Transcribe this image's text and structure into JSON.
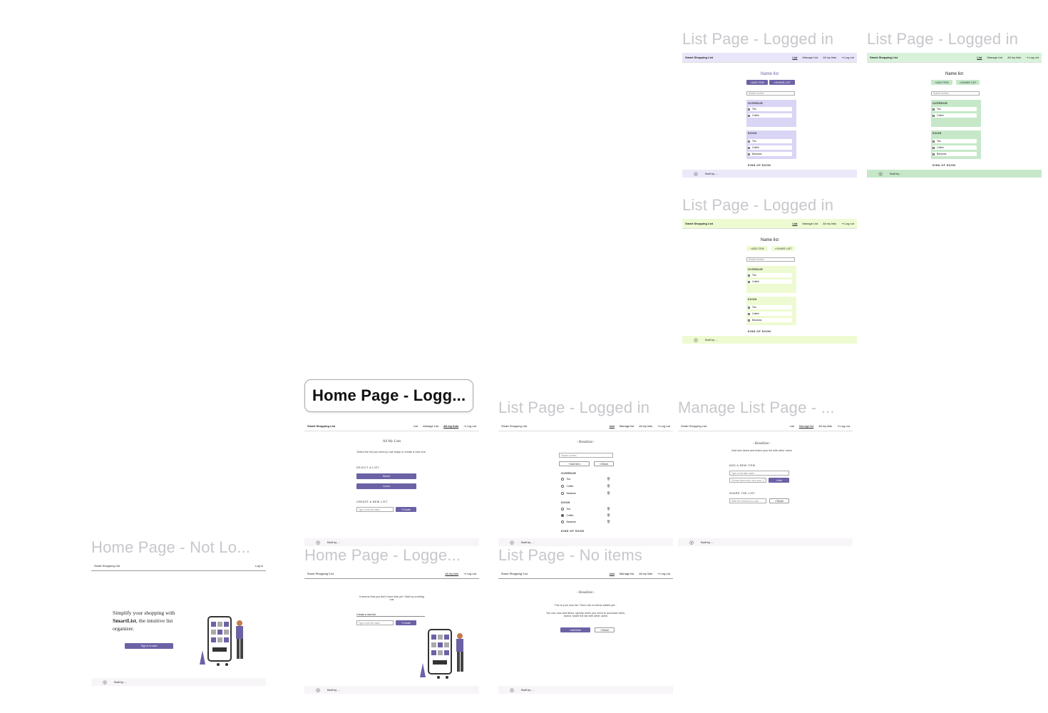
{
  "frames": {
    "list_purple": "List Page - Logged in",
    "list_green": "List Page - Logged in",
    "list_lime": "List Page - Logged in",
    "home_logged": "Home Page - Logg...",
    "list_main": "List Page - Logged in",
    "manage": "Manage List Page - ...",
    "home_not": "Home Page - Not Lo...",
    "home_logged2": "Home Page - Logge...",
    "list_empty": "List Page - No items"
  },
  "nav": {
    "brand": "Smart Shopping List",
    "list": "List",
    "manage": "Manage List",
    "manage_lc": "Manage list",
    "all": "All my lists",
    "logout": "Log out",
    "login": "Log in"
  },
  "footer": "Built by ...",
  "variant": {
    "title": "Name list",
    "add_item": "ADD ITEM",
    "share": "SHARE LIST",
    "search": "Search an item",
    "overdue": "OVERDUE",
    "soon": "SOON",
    "kind": "KIND OF SOON",
    "tea": "Tea",
    "coffee": "Coffee",
    "bananas": "Bananas"
  },
  "home": {
    "title": "All My Lists",
    "intro": "Select the list you need yo use today or create a new one.",
    "select": "SELECT A LIST",
    "list1": "Dinner",
    "list2": "Lunch",
    "create": "CREATE A NEW LIST",
    "placeholder": "Type a new list name",
    "create_btn": "Create"
  },
  "list": {
    "title": "- Breakfast -",
    "search": "Search an item",
    "add": "Add item",
    "share": "Share",
    "overdue": "OVERDUE",
    "soon": "SOON",
    "kind": "KIND OF SOON",
    "tea": "Tea",
    "coffee": "Coffee",
    "bananas": "Bananas"
  },
  "manage": {
    "title": "- Breakfast -",
    "intro": "Add new items and share your list with other users",
    "add_label": "ADD A NEW ITEM",
    "item_ph": "Type a new item name",
    "when_ph": "Choose when next, very soon, (7",
    "add_btn": "Add",
    "share_label": "SHARE THE LIST",
    "share_ph": "Write the email from a user",
    "share_btn": "Share"
  },
  "not_logged": {
    "line1": "Simplify your shopping with",
    "brand": "SmartList",
    "line2": ", the intuitive list organizer.",
    "cta": "Sign in to start"
  },
  "no_lists": {
    "intro": "It seems that you don't have lists yet. Start by creating one",
    "create": "Create a new list",
    "placeholder": "Type a new list name",
    "btn": "Create"
  },
  "empty": {
    "title": "- Breakfast -",
    "line1": "This is your new list. There are no items added yet...",
    "line2": "You can now add items, specify when you need to purchase them, and/or share the list with other users",
    "add": "Add item",
    "share": "Share"
  },
  "colors": {
    "purple": "#6b62a6",
    "lavender": "#d9d5f5",
    "green": "#c6e8c9",
    "lime": "#eefbd2",
    "title_gray": "#c7c7cc"
  }
}
